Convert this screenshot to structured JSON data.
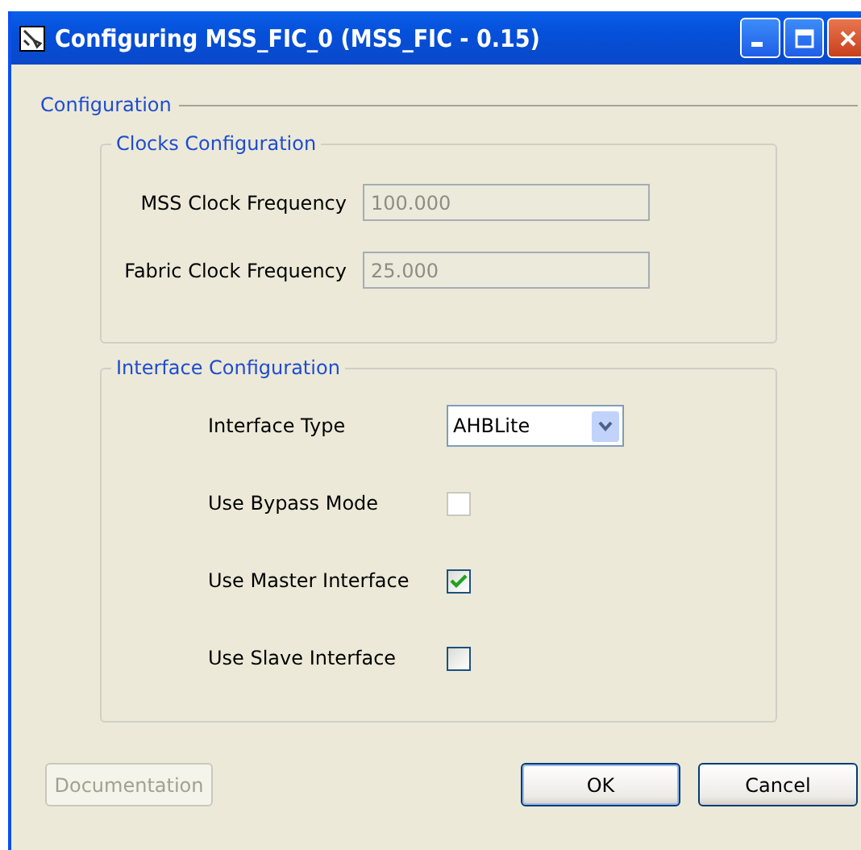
{
  "window": {
    "title": "Configuring MSS_FIC_0 (MSS_FIC - 0.15)"
  },
  "configuration": {
    "title": "Configuration",
    "clocks": {
      "title": "Clocks Configuration",
      "fields": [
        {
          "label": "MSS Clock Frequency",
          "value": "100.000",
          "disabled": true
        },
        {
          "label": "Fabric Clock Frequency",
          "value": "25.000",
          "disabled": true
        }
      ]
    },
    "interface": {
      "title": "Interface Configuration",
      "rows": [
        {
          "kind": "dropdown",
          "label": "Interface Type",
          "value": "AHBLite"
        },
        {
          "kind": "checkbox",
          "label": "Use Bypass Mode",
          "checked": false,
          "disabled": true
        },
        {
          "kind": "checkbox",
          "label": "Use Master Interface",
          "checked": true,
          "disabled": false
        },
        {
          "kind": "checkbox",
          "label": "Use Slave Interface",
          "checked": false,
          "disabled": false
        }
      ]
    }
  },
  "buttons": [
    {
      "label": "Documentation",
      "disabled": true
    },
    {
      "label": "OK",
      "disabled": false,
      "default": true
    },
    {
      "label": "Cancel",
      "disabled": false,
      "default": false
    }
  ]
}
